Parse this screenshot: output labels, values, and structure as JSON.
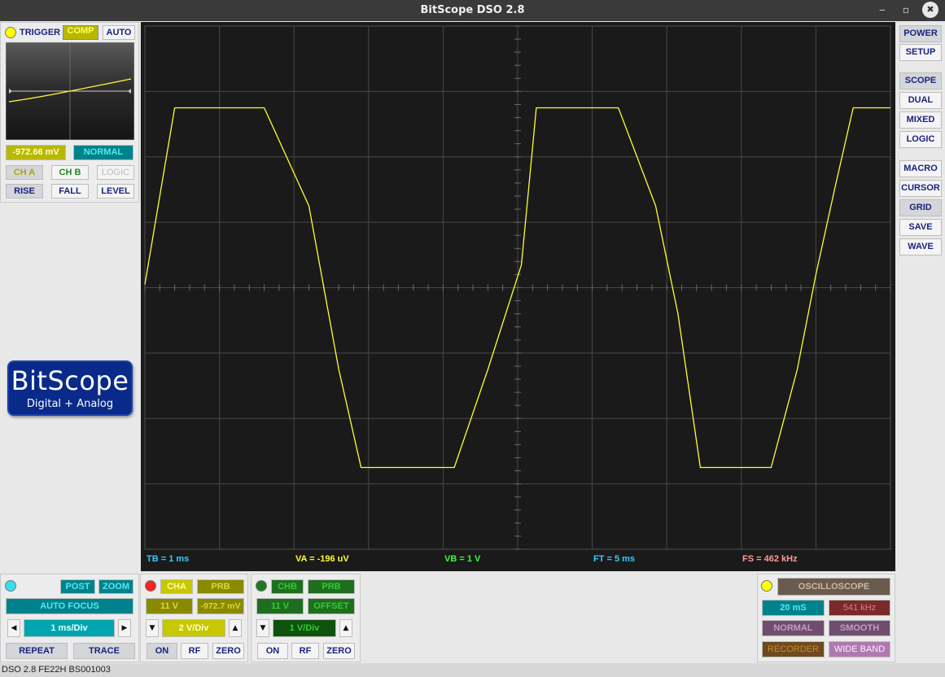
{
  "window": {
    "title": "BitScope DSO 2.8",
    "minimize": "‒",
    "restore": "▫",
    "close": "✖"
  },
  "trigger": {
    "label": "TRIGGER",
    "comp": "COMP",
    "auto": "AUTO",
    "level_value": "-972.66 mV",
    "mode": "NORMAL",
    "source_a": "CH A",
    "source_b": "CH B",
    "source_logic": "LOGIC",
    "rise": "RISE",
    "fall": "FALL",
    "level": "LEVEL"
  },
  "logo": {
    "brand": "BitScope",
    "tagline": "Digital + Analog"
  },
  "right_menu": {
    "power": "POWER",
    "setup": "SETUP",
    "scope": "SCOPE",
    "dual": "DUAL",
    "mixed": "MIXED",
    "logic": "LOGIC",
    "macro": "MACRO",
    "cursor": "CURSOR",
    "grid": "GRID",
    "save": "SAVE",
    "wave": "WAVE"
  },
  "readouts": {
    "tb": "TB = 1 ms",
    "va": "VA = -196 uV",
    "vb": "VB = 1 V",
    "ft": "FT = 5 ms",
    "fs": "FS = 462 kHz"
  },
  "timebase": {
    "post": "POST",
    "zoom": "ZOOM",
    "auto_focus": "AUTO FOCUS",
    "value": "1 ms/Div",
    "repeat": "REPEAT",
    "trace": "TRACE"
  },
  "cha": {
    "label": "CHA",
    "prb": "PRB",
    "range": "11 V",
    "offset": "-972.7 mV",
    "vdiv": "2 V/Div",
    "on": "ON",
    "rf": "RF",
    "zero": "ZERO"
  },
  "chb": {
    "label": "CHB",
    "prb": "PRB",
    "range": "11 V",
    "offset": "OFFSET",
    "vdiv": "1 V/Div",
    "on": "ON",
    "rf": "RF",
    "zero": "ZERO"
  },
  "capture": {
    "mode": "OSCILLOSCOPE",
    "duration": "20 mS",
    "rate": "541 kHz",
    "normal": "NORMAL",
    "smooth": "SMOOTH",
    "recorder": "RECORDER",
    "wide_band": "WIDE BAND"
  },
  "status": {
    "text": "DSO 2.8 FE22H BS001003"
  },
  "colors": {
    "trace_a": "#ffff33",
    "cha_accent": "#c8c800",
    "chb_accent": "#1f6e1f",
    "timebase_accent": "#00828c",
    "readout_tb": "#33ccff",
    "readout_va": "#ffff33",
    "readout_vb": "#33ff33",
    "readout_ft": "#33ccff",
    "readout_fs": "#ff9999"
  },
  "chart_data": {
    "type": "line",
    "xlabel": "",
    "ylabel": "",
    "xlim": [
      0,
      10
    ],
    "ylim": [
      -8,
      8
    ],
    "grid": true,
    "series": [
      {
        "x": [
          0,
          0.4,
          1.6,
          2.2,
          2.6,
          2.9,
          3.35,
          4.15,
          4.6,
          5.05,
          5.25,
          5.35,
          6.35,
          6.85,
          7.15,
          7.45,
          8.0,
          8.4,
          8.75,
          9.0,
          9.25,
          9.5,
          10
        ],
        "y": [
          0.1,
          5.5,
          5.5,
          2.5,
          -2.5,
          -5.5,
          -5.5,
          -5.5,
          -2.5,
          0.7,
          5.5,
          5.5,
          5.5,
          2.5,
          -0.8,
          -5.5,
          -5.5,
          -5.5,
          -2.5,
          0.4,
          3.0,
          5.5,
          5.5
        ]
      }
    ]
  }
}
